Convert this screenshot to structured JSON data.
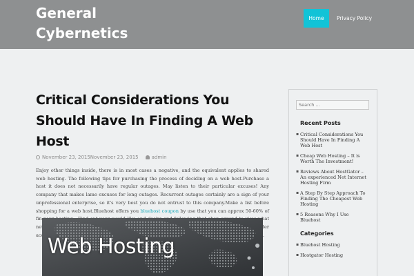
{
  "site": {
    "title": "General Cybernetics"
  },
  "nav": {
    "items": [
      {
        "label": "Home"
      },
      {
        "label": "Privacy Policy"
      }
    ]
  },
  "post": {
    "title": "Critical Considerations You Should Have In Finding A Web Host",
    "date": "November 23, 2015November 23, 2015",
    "author": "admin",
    "body_before_link": "Enjoy other things inside, there is in most cases a negative, and the equivalent applies to shared web hosting. The following tips for purchasing the process of deciding on a web host.Purchase a host it does not necessarily have regular outages. May listen to their particular excuses! Any company that makes lame excuses for long outages. Recurrent outages certainly are a sign of your unprofessional enterprise, so it's very best you do not entrust to this company.Make a list before shopping for a web host.Bluehost offers you ",
    "link_text": "bluehost coupon",
    "body_after_link": " by use that you can approx 50-60% of fin your hosting . Find out your would like and desire and following that shop around to view what net hosts complements these anticipations. Using a top priority list stop you from picking a provider according to a single aspect, like selling price, and instead locate what you need with a great deal.",
    "image_caption": "Web Hosting"
  },
  "sidebar": {
    "search_placeholder": "Search ...",
    "recent_title": "Recent Posts",
    "recent": [
      {
        "label": "Critical Considerations You Should Have In Finding A Web Host"
      },
      {
        "label": "Cheap Web Hosting – It is Worth The Investment!"
      },
      {
        "label": "Reviews About HostGator – An experienced Net Internet Hosting Firm"
      },
      {
        "label": "A Step By Step Approach To Finding The Cheapest Web Hosting"
      },
      {
        "label": "5 Reasons Why I Use Bluehost"
      }
    ],
    "categories_title": "Categories",
    "categories": [
      {
        "label": "Bluehost Hosting"
      },
      {
        "label": "Hostgator Hosting"
      }
    ]
  },
  "colors": {
    "header_bg": "#8e9091",
    "accent": "#12c3d7",
    "link": "#12a5b7"
  }
}
